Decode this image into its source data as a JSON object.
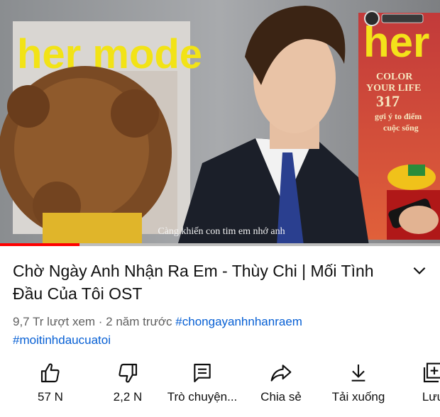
{
  "video": {
    "subtitle": "Càng khiến con tim em nhớ anh",
    "magazine_left": "her mode",
    "magazine_right": "her",
    "magazine_right_lines": [
      "COLOR",
      "YOUR LIFE",
      "317",
      "gợi ý to điểm",
      "cuộc sống"
    ],
    "progress": 0.18,
    "accent_color": "#ff0000"
  },
  "info": {
    "title": "Chờ Ngày Anh Nhận Ra Em  - Thùy Chi | Mối Tình Đầu Của Tôi OST",
    "views": "9,7 Tr lượt xem",
    "separator": " · ",
    "age": "2 năm trước",
    "hashtags": [
      "#chongayanhnhanraem",
      "#moitinhdaucuatoi"
    ],
    "hashtag_color": "#065fd4",
    "expand_icon": "chevron-down-icon"
  },
  "actions": [
    {
      "icon": "thumbs-up-icon",
      "label": "57 N"
    },
    {
      "icon": "thumbs-down-icon",
      "label": "2,2 N"
    },
    {
      "icon": "chat-icon",
      "label": "Trò chuyện..."
    },
    {
      "icon": "share-icon",
      "label": "Chia sẻ"
    },
    {
      "icon": "download-icon",
      "label": "Tải xuống"
    },
    {
      "icon": "save-icon",
      "label": "Lưu"
    }
  ]
}
